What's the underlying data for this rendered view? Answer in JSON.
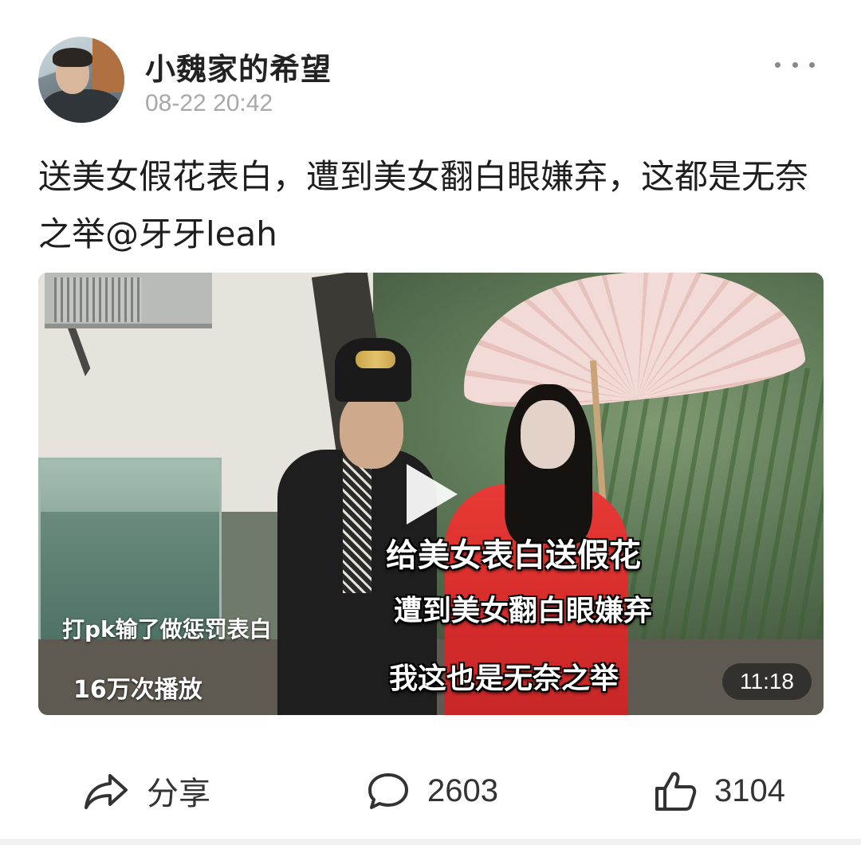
{
  "post": {
    "author": "小魏家的希望",
    "timestamp": "08-22 20:42",
    "text": "送美女假花表白，遭到美女翻白眼嫌弃，这都是无奈之举@牙牙leah"
  },
  "video": {
    "caption_line1": "给美女表白送假花",
    "caption_line2": "遭到美女翻白眼嫌弃",
    "caption_line3": "我这也是无奈之举",
    "overlay_text": "打pk输了做惩罚表白",
    "play_count": "16万次播放",
    "duration": "11:18"
  },
  "actions": {
    "share_label": "分享",
    "comment_count": "2603",
    "like_count": "3104"
  },
  "icons": {
    "more": "more-dots-icon",
    "share": "share-arrow-icon",
    "comment": "comment-bubble-icon",
    "like": "thumbs-up-icon",
    "play": "play-icon"
  }
}
